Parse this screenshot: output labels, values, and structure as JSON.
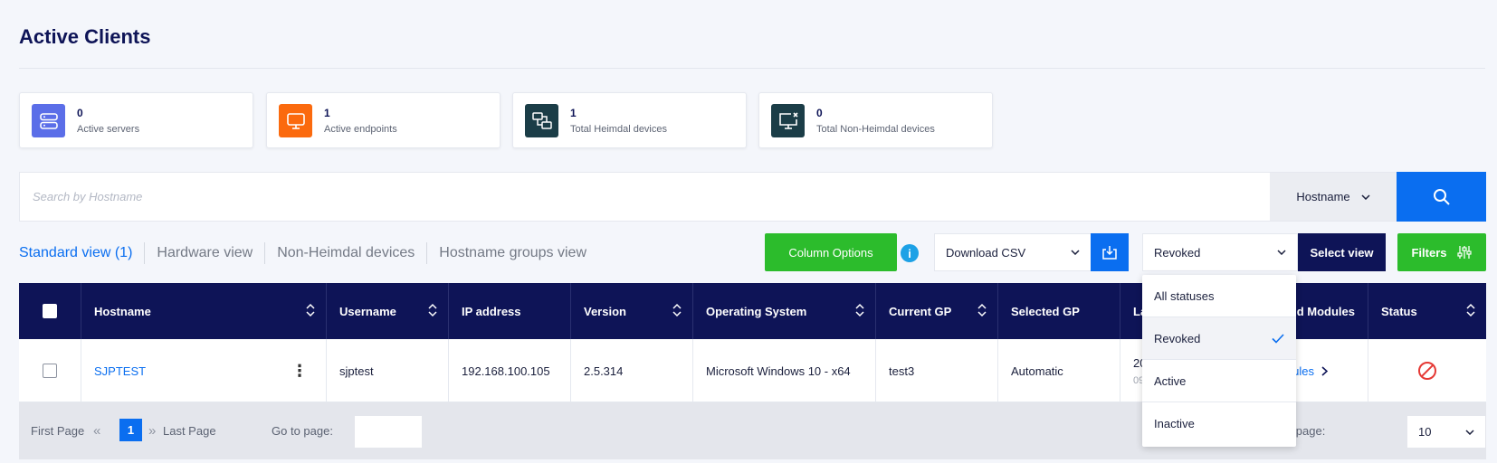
{
  "page": {
    "title": "Active Clients"
  },
  "cards": [
    {
      "count": "0",
      "label": "Active servers",
      "icon": "server-icon",
      "color": "#5b6ee8"
    },
    {
      "count": "1",
      "label": "Active endpoints",
      "icon": "monitor-icon",
      "color": "#fb6a0e"
    },
    {
      "count": "1",
      "label": "Total Heimdal devices",
      "icon": "network-devices-icon",
      "color": "#1b3d47"
    },
    {
      "count": "0",
      "label": "Total Non-Heimdal devices",
      "icon": "monitor-x-icon",
      "color": "#1b3d47"
    }
  ],
  "search": {
    "placeholder": "Search by Hostname",
    "field": "Hostname"
  },
  "tabs": [
    "Standard view (1)",
    "Hardware view",
    "Non-Heimdal devices",
    "Hostname groups view"
  ],
  "toolbar": {
    "column_options": "Column Options",
    "download": "Download CSV",
    "status_selected": "Revoked",
    "select_view": "Select view",
    "filters": "Filters"
  },
  "table": {
    "columns": [
      "Hostname",
      "Username",
      "IP address",
      "Version",
      "Operating System",
      "Current GP",
      "Selected GP",
      "La",
      "d Modules",
      "Status"
    ],
    "rows": [
      {
        "hostname": "SJPTEST",
        "username": "sjptest",
        "ip": "192.168.100.105",
        "version": "2.5.314",
        "os": "Microsoft Windows 10 - x64",
        "current_gp": "test3",
        "selected_gp": "Automatic",
        "last_seen_top": "20",
        "last_seen_bottom": "09",
        "modules_link": "ules"
      }
    ]
  },
  "pagination": {
    "first": "First Page",
    "current": "1",
    "last": "Last Page",
    "goto_label": "Go to page:",
    "per_page_label": "Items per page:",
    "per_page_value": "10"
  },
  "status_dropdown": {
    "options": [
      "All statuses",
      "Revoked",
      "Active",
      "Inactive"
    ]
  }
}
